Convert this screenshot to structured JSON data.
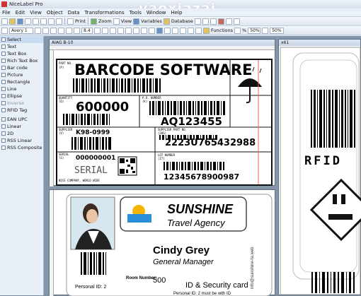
{
  "window": {
    "title": "NiceLabel Pro"
  },
  "watermark": "yaoxiazai",
  "menu": [
    "File",
    "Edit",
    "View",
    "Object",
    "Data",
    "Transformations",
    "Tools",
    "Window",
    "Help"
  ],
  "toolbar1": {
    "print_label": "Print",
    "zoom_label": "Zoom",
    "view_label": "View",
    "variables_label": "Variables",
    "database_label": "Database"
  },
  "toolbar2": {
    "printer": "Avery 1",
    "font_size": "8.4",
    "functions_label": "Functions",
    "zoom_value": "50%",
    "zoom_percent": "%",
    "zoom_display": "50%"
  },
  "toolbox": {
    "items": [
      "Select",
      "Text",
      "Text Box",
      "Rich Text Box",
      "Bar code",
      "Picture",
      "Rectangle",
      "Line",
      "Ellipse",
      "Inverse",
      "RFID Tag",
      "EAN UPC",
      "Linear",
      "2D",
      "RSS Linear",
      "RSS Composite"
    ]
  },
  "doc1": {
    "title": "AIAG B-10"
  },
  "doc3": {
    "title": "x61"
  },
  "label1": {
    "part_no_label": "PART NO.",
    "part_no_code": "(P)",
    "heading": "BARCODE SOFTWARE",
    "quantity_label": "QUANTITY",
    "quantity_code": "(Q)",
    "quantity": "600000",
    "po_label": "P.O. NUMBER",
    "po_code": "(K)",
    "po_number": "AQ123455",
    "supplier_label": "SUPPLIER",
    "supplier_code": "(V)",
    "supplier": "K98-0999",
    "supplier_part_label": "SUPPLIER PART NO.",
    "supplier_part_code": "(30S)",
    "supplier_part": "2223U765432988",
    "serial_label": "SERIAL",
    "serial_code": "(S)",
    "serial": "000000001",
    "serial_word": "SERIAL",
    "lot_label": "LOT NUMBER",
    "lot_code": "(1T)",
    "lot": "12345678900987",
    "footer": "NICE COMPANY, WORLD WIDE"
  },
  "label2": {
    "brand": "SUNSHINE",
    "brand_sub": "Travel Agency",
    "name": "Cindy Grey",
    "role": "General Manager",
    "room_label": "Room Number:",
    "room": "500",
    "card_type": "ID & Security card",
    "personal_id": "Personal ID: 2",
    "side_email": "info@sunshine-ta.web",
    "bottom_text": "Personal ID: 2 must be with ID"
  },
  "label3": {
    "rfid": "RFID"
  }
}
